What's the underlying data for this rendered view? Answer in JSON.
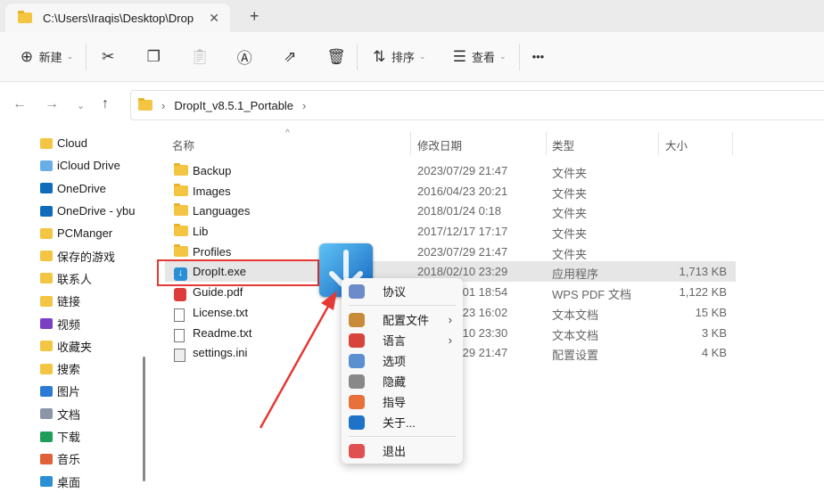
{
  "tab": {
    "title": "C:\\Users\\Iraqis\\Desktop\\Drop",
    "close": "✕",
    "new": "+"
  },
  "toolbar": {
    "new_label": "新建",
    "sort_label": "排序",
    "view_label": "查看",
    "more": "•••"
  },
  "address": {
    "crumbs": [
      "DropIt_v8.5.1_Portable"
    ]
  },
  "sidebar": {
    "items": [
      {
        "label": "Cloud",
        "color": "#f4c542"
      },
      {
        "label": "iCloud Drive",
        "color": "#6aaee8"
      },
      {
        "label": "OneDrive",
        "color": "#0f6cbd"
      },
      {
        "label": "OneDrive - ybu",
        "color": "#0f6cbd"
      },
      {
        "label": "PCManger",
        "color": "#f4c542"
      },
      {
        "label": "保存的游戏",
        "color": "#f4c542"
      },
      {
        "label": "联系人",
        "color": "#f4c542"
      },
      {
        "label": "链接",
        "color": "#f4c542"
      },
      {
        "label": "视频",
        "color": "#7b3fc4"
      },
      {
        "label": "收藏夹",
        "color": "#f4c542"
      },
      {
        "label": "搜索",
        "color": "#f4c542"
      },
      {
        "label": "图片",
        "color": "#2b7bd6"
      },
      {
        "label": "文档",
        "color": "#8a96a8"
      },
      {
        "label": "下载",
        "color": "#1e9e5a"
      },
      {
        "label": "音乐",
        "color": "#e0603a"
      },
      {
        "label": "桌面",
        "color": "#2b8fd6"
      }
    ]
  },
  "columns": {
    "name": "名称",
    "date": "修改日期",
    "type": "类型",
    "size": "大小"
  },
  "files": [
    {
      "name": "Backup",
      "date": "2023/07/29 21:47",
      "type": "文件夹",
      "size": "",
      "icon": "folder"
    },
    {
      "name": "Images",
      "date": "2016/04/23 20:21",
      "type": "文件夹",
      "size": "",
      "icon": "folder"
    },
    {
      "name": "Languages",
      "date": "2018/01/24 0:18",
      "type": "文件夹",
      "size": "",
      "icon": "folder"
    },
    {
      "name": "Lib",
      "date": "2017/12/17 17:17",
      "type": "文件夹",
      "size": "",
      "icon": "folder"
    },
    {
      "name": "Profiles",
      "date": "2023/07/29 21:47",
      "type": "文件夹",
      "size": "",
      "icon": "folder"
    },
    {
      "name": "DropIt.exe",
      "date": "2018/02/10 23:29",
      "type": "应用程序",
      "size": "1,713 KB",
      "icon": "exe"
    },
    {
      "name": "Guide.pdf",
      "date": "2018/02/01 18:54",
      "type": "WPS PDF 文档",
      "size": "1,122 KB",
      "icon": "pdf"
    },
    {
      "name": "License.txt",
      "date": "2018/01/23 16:02",
      "type": "文本文档",
      "size": "15 KB",
      "icon": "txt"
    },
    {
      "name": "Readme.txt",
      "date": "2018/02/10 23:30",
      "type": "文本文档",
      "size": "3 KB",
      "icon": "txt"
    },
    {
      "name": "settings.ini",
      "date": "2023/07/29 21:47",
      "type": "配置设置",
      "size": "4 KB",
      "icon": "ini"
    }
  ],
  "context_menu": {
    "items": [
      {
        "label": "协议",
        "color": "#6b8cc9",
        "sub": false
      },
      {
        "label": "配置文件",
        "color": "#c98a3a",
        "sub": true
      },
      {
        "label": "语言",
        "color": "#d8443c",
        "sub": true
      },
      {
        "label": "选项",
        "color": "#5a8fd0",
        "sub": false
      },
      {
        "label": "隐藏",
        "color": "#888888",
        "sub": false
      },
      {
        "label": "指导",
        "color": "#e8703a",
        "sub": false
      },
      {
        "label": "关于...",
        "color": "#1e73c8",
        "sub": false
      },
      {
        "label": "退出",
        "color": "#e05050",
        "sub": false
      }
    ]
  },
  "accent": "#e53935"
}
